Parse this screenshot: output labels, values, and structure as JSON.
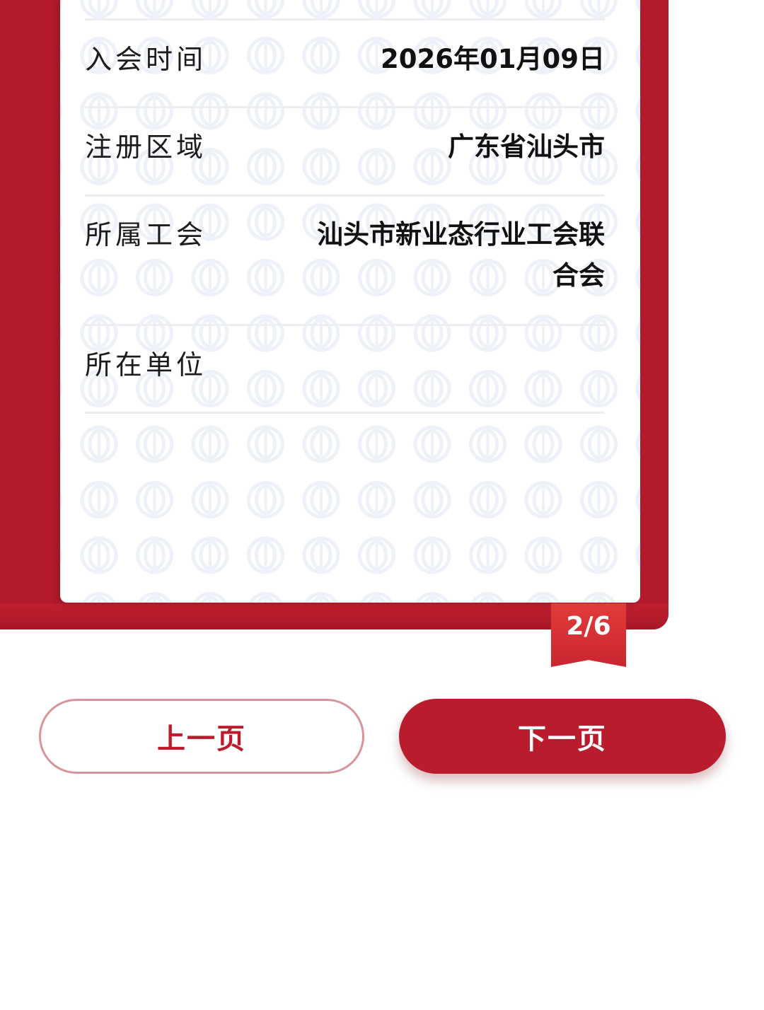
{
  "fields": [
    {
      "label": "入会时间",
      "value": "2026年01月09日"
    },
    {
      "label": "注册区域",
      "value": "广东省汕头市"
    },
    {
      "label": "所属工会",
      "value": "汕头市新业态行业工会联合会"
    },
    {
      "label": "所在单位",
      "value": ""
    }
  ],
  "pager": {
    "indicator": "2/6"
  },
  "nav": {
    "prev_label": "上一页",
    "next_label": "下一页"
  },
  "colors": {
    "brand_red": "#b81c2d",
    "badge_red": "#d92f33",
    "watermark": "#eef1f8"
  },
  "icons": {
    "watermark": "union-emblem-icon"
  }
}
